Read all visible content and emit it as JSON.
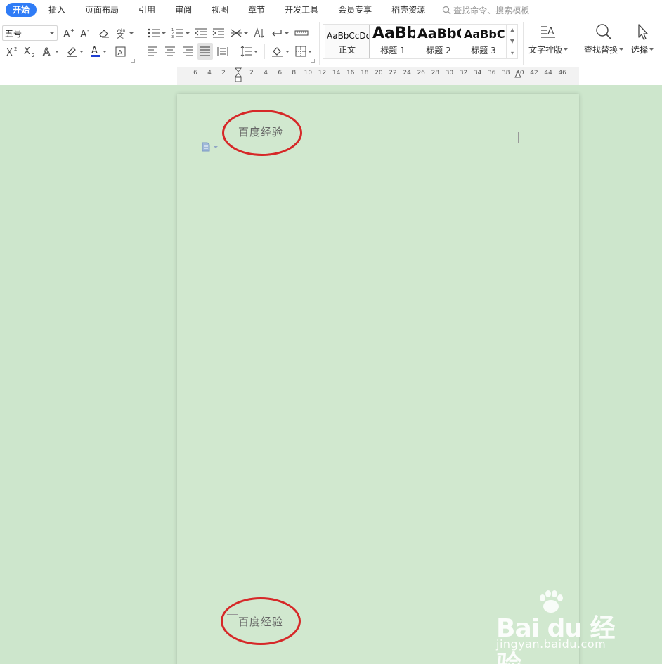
{
  "tabs": [
    {
      "label": "开始",
      "active": true
    },
    {
      "label": "插入"
    },
    {
      "label": "页面布局"
    },
    {
      "label": "引用"
    },
    {
      "label": "审阅"
    },
    {
      "label": "视图"
    },
    {
      "label": "章节"
    },
    {
      "label": "开发工具"
    },
    {
      "label": "会员专享"
    },
    {
      "label": "稻壳资源"
    }
  ],
  "command_search": {
    "placeholder": "查找命令、搜索模板"
  },
  "font": {
    "size": "五号"
  },
  "styles": [
    {
      "sample": "AaBbCcDd",
      "name": "正文"
    },
    {
      "sample": "AaBb",
      "name": "标题 1"
    },
    {
      "sample": "AaBbC",
      "name": "标题 2"
    },
    {
      "sample": "AaBbCc",
      "name": "标题 3"
    }
  ],
  "buttons": {
    "text_layout": "文字排版",
    "find_replace": "查找替换",
    "select": "选择"
  },
  "ruler": {
    "ticks": [
      "6",
      "4",
      "2",
      "2",
      "4",
      "6",
      "8",
      "10",
      "12",
      "14",
      "16",
      "18",
      "20",
      "22",
      "24",
      "26",
      "28",
      "30",
      "32",
      "34",
      "36",
      "38",
      "40",
      "42",
      "44",
      "46"
    ]
  },
  "document": {
    "header_text": "百度经验",
    "footer_text": "百度经验"
  },
  "watermark": {
    "logo": "Bai du 经验",
    "url": "jingyan.baidu.com"
  },
  "colors": {
    "accent": "#2f7cf6",
    "annotation": "#d62828",
    "page_bg": "#d1e8cf",
    "workspace_bg": "#cde6cc"
  }
}
